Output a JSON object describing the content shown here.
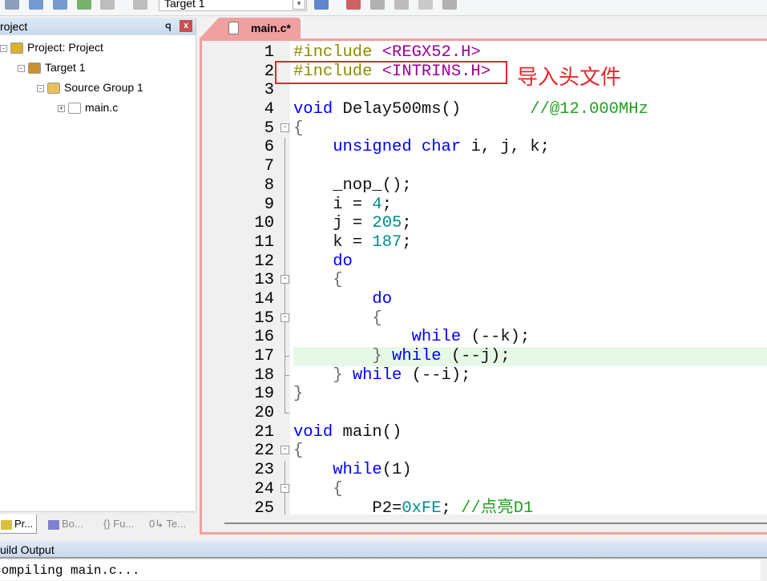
{
  "toolbar": {
    "target_select": "Target 1",
    "icons": [
      "batch-build-icon",
      "build-icon",
      "rebuild-icon",
      "download-icon",
      "options-icon",
      "debug-icon",
      "manage-icon",
      "component-icon",
      "window-icon",
      "dropdown-icon",
      "filter-icon",
      "settings-icon"
    ]
  },
  "project_panel": {
    "title": "roject",
    "pin": "ꟼ",
    "close": "x",
    "tree": [
      {
        "label": "Project: Project",
        "icon": "project-icon",
        "expander": "-"
      },
      {
        "label": "Target 1",
        "icon": "target-icon",
        "expander": "-"
      },
      {
        "label": "Source Group 1",
        "icon": "folder-icon",
        "expander": "-"
      },
      {
        "label": "main.c",
        "icon": "file-icon",
        "expander": "+"
      }
    ],
    "tabs": [
      {
        "label": "Pr...",
        "icon": "project-tab-icon",
        "active": true
      },
      {
        "label": "Bo...",
        "icon": "books-icon",
        "active": false
      },
      {
        "label": "{} Fu...",
        "icon": "functions-icon",
        "active": false
      },
      {
        "label": "0↳ Te...",
        "icon": "templates-icon",
        "active": false
      }
    ]
  },
  "editor": {
    "tab_label": "main.c*",
    "highlighted_line": 17,
    "lines": [
      {
        "n": "1",
        "t": [
          [
            "pp",
            "#include "
          ],
          [
            "inc",
            "<REGX52.H>"
          ]
        ]
      },
      {
        "n": "2",
        "t": [
          [
            "pp",
            "#include "
          ],
          [
            "inc",
            "<INTRINS.H>"
          ]
        ]
      },
      {
        "n": "3",
        "t": []
      },
      {
        "n": "4",
        "t": [
          [
            "kw",
            "void "
          ],
          [
            "tx",
            "Delay500ms()       "
          ],
          [
            "cm",
            "//@12.000MHz"
          ]
        ]
      },
      {
        "n": "5",
        "fold": "-",
        "t": [
          [
            "br",
            "{"
          ]
        ]
      },
      {
        "n": "6",
        "t": [
          [
            "tx",
            "    "
          ],
          [
            "kw",
            "unsigned char "
          ],
          [
            "tx",
            "i, j, k;"
          ]
        ]
      },
      {
        "n": "7",
        "t": []
      },
      {
        "n": "8",
        "t": [
          [
            "tx",
            "    _nop_();"
          ]
        ]
      },
      {
        "n": "9",
        "t": [
          [
            "tx",
            "    i = "
          ],
          [
            "num",
            "4"
          ],
          [
            "tx",
            ";"
          ]
        ]
      },
      {
        "n": "10",
        "t": [
          [
            "tx",
            "    j = "
          ],
          [
            "num",
            "205"
          ],
          [
            "tx",
            ";"
          ]
        ]
      },
      {
        "n": "11",
        "t": [
          [
            "tx",
            "    k = "
          ],
          [
            "num",
            "187"
          ],
          [
            "tx",
            ";"
          ]
        ]
      },
      {
        "n": "12",
        "t": [
          [
            "tx",
            "    "
          ],
          [
            "kw",
            "do"
          ]
        ]
      },
      {
        "n": "13",
        "fold": "-",
        "t": [
          [
            "tx",
            "    "
          ],
          [
            "br",
            "{"
          ]
        ]
      },
      {
        "n": "14",
        "t": [
          [
            "tx",
            "        "
          ],
          [
            "kw",
            "do"
          ]
        ]
      },
      {
        "n": "15",
        "fold": "-",
        "t": [
          [
            "tx",
            "        "
          ],
          [
            "br",
            "{"
          ]
        ]
      },
      {
        "n": "16",
        "t": [
          [
            "tx",
            "            "
          ],
          [
            "kw",
            "while "
          ],
          [
            "tx",
            "(--k);"
          ]
        ]
      },
      {
        "n": "17",
        "t": [
          [
            "tx",
            "        "
          ],
          [
            "br",
            "} "
          ],
          [
            "kw",
            "while "
          ],
          [
            "tx",
            "(--j);"
          ]
        ]
      },
      {
        "n": "18",
        "t": [
          [
            "tx",
            "    "
          ],
          [
            "br",
            "} "
          ],
          [
            "kw",
            "while "
          ],
          [
            "tx",
            "(--i);"
          ]
        ]
      },
      {
        "n": "19",
        "t": [
          [
            "br",
            "}"
          ]
        ]
      },
      {
        "n": "20",
        "t": []
      },
      {
        "n": "21",
        "t": [
          [
            "kw",
            "void "
          ],
          [
            "tx",
            "main()"
          ]
        ]
      },
      {
        "n": "22",
        "fold": "-",
        "t": [
          [
            "br",
            "{"
          ]
        ]
      },
      {
        "n": "23",
        "t": [
          [
            "tx",
            "    "
          ],
          [
            "kw",
            "while"
          ],
          [
            "tx",
            "(1)"
          ]
        ]
      },
      {
        "n": "24",
        "fold": "-",
        "t": [
          [
            "tx",
            "    "
          ],
          [
            "br",
            "{"
          ]
        ]
      },
      {
        "n": "25",
        "t": [
          [
            "tx",
            "        P2="
          ],
          [
            "num",
            "0xFE"
          ],
          [
            "tx",
            "; "
          ],
          [
            "cm",
            "//点亮D1"
          ]
        ]
      }
    ]
  },
  "annotation": {
    "text": "导入头文件",
    "color": "#e8262b"
  },
  "build_output": {
    "title": "uild Output",
    "text": "compiling main.c..."
  },
  "colors": {
    "keyword": "#0000ff",
    "preprocessor": "#8c8c00",
    "include": "#990099",
    "number": "#008b8b",
    "comment": "#22a022",
    "tab": "#f0a0a0",
    "current_line": "#e6f9e6"
  }
}
